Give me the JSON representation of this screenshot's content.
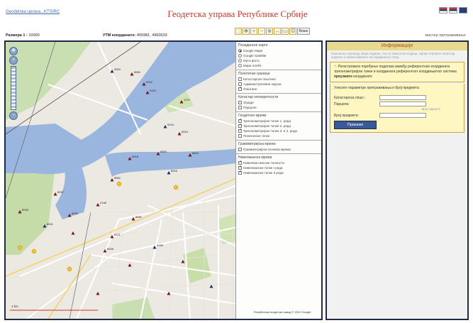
{
  "header": {
    "login_link": "Geodetska uprava...KTS/RC",
    "title": "Геодетска управа Републике Србије"
  },
  "scalebar": {
    "scale_label": "Размера 1 :",
    "scale_value": "10000",
    "utm_label": "УТМ координате:",
    "utm_value": "455981, 4960033",
    "search_link": "мастер претраживање"
  },
  "toolbar": {
    "more_label": "Више"
  },
  "layers": {
    "base_title": "Позадинске карте",
    "base_items": [
      {
        "label": "Google Maps",
        "on": true
      },
      {
        "label": "Google Satellite",
        "on": false
      },
      {
        "label": "Орто фото",
        "on": false
      },
      {
        "label": "Mapa mreže",
        "on": false
      }
    ],
    "admin_title": "Политичке границе",
    "admin_items": [
      {
        "label": "Катастарске општине",
        "on": false
      },
      {
        "label": "Административни окрузи",
        "on": false
      },
      {
        "label": "Општине",
        "on": true
      }
    ],
    "cadastre_title": "Катастар непокретности",
    "cadastre_items": [
      {
        "label": "Зграде",
        "on": false
      },
      {
        "label": "Парцеле",
        "on": false
      }
    ],
    "geodetic_title": "Геодетске мреже",
    "geodetic_items": [
      {
        "label": "Тригонометријске тачке 1. реда",
        "on": true
      },
      {
        "label": "Тригонометријске тачке 2. реда",
        "on": true
      },
      {
        "label": "Тригонометријске тачке 3. и 4. реда",
        "on": true
      },
      {
        "label": "Полигонске тачке",
        "on": false
      }
    ],
    "gravity_title": "Гравиметријска мрежа",
    "gravity_items": [
      {
        "label": "Гравиметријска основна мрежа",
        "on": false
      }
    ],
    "height_title": "Нивелманска мрежа",
    "height_items": [
      {
        "label": "Нивелман високе тачности",
        "on": true
      },
      {
        "label": "Нивелманске тачке I реда",
        "on": true
      },
      {
        "label": "Нивелманске тачке II реда",
        "on": true
      }
    ]
  },
  "info": {
    "header": "Информације",
    "hint": "Кликом на стрелицу: Бира податке, Ако су смештени подаци, најпре отворите катастар податке; а затим кликните на појединачну тачку.",
    "message_pre": "Регистровано поређење података између референтних координата тригонометријске тачке и координата референтног коордињатног система ",
    "message_bold": "преузмите",
    "message_post": " координате ",
    "form_title": "Унесите параметре претраживања и број предмета:",
    "field1": "Катастарска општ.:",
    "field2": "Парцела:",
    "field_sub": "Број парцеле",
    "field3": "Број предмета:",
    "button": "Прикажи"
  },
  "map": {
    "scale_caption": "1 km",
    "copyright": "Републички геодетски завод © 2012 Google",
    "labels": [
      "9054",
      "8960",
      "8752",
      "9103",
      "1270",
      "9104",
      "8924",
      "8918",
      "8953",
      "8904",
      "8916",
      "8962",
      "2148",
      "8937",
      "8930",
      "8941",
      "8943",
      "8951",
      "9121",
      "8908",
      "3165"
    ]
  },
  "colors": {
    "frame": "#1e2b47",
    "title": "#c0392b",
    "water": "#9ab6de",
    "panel_yellow": "#fff7c2",
    "button": "#3b5998"
  }
}
